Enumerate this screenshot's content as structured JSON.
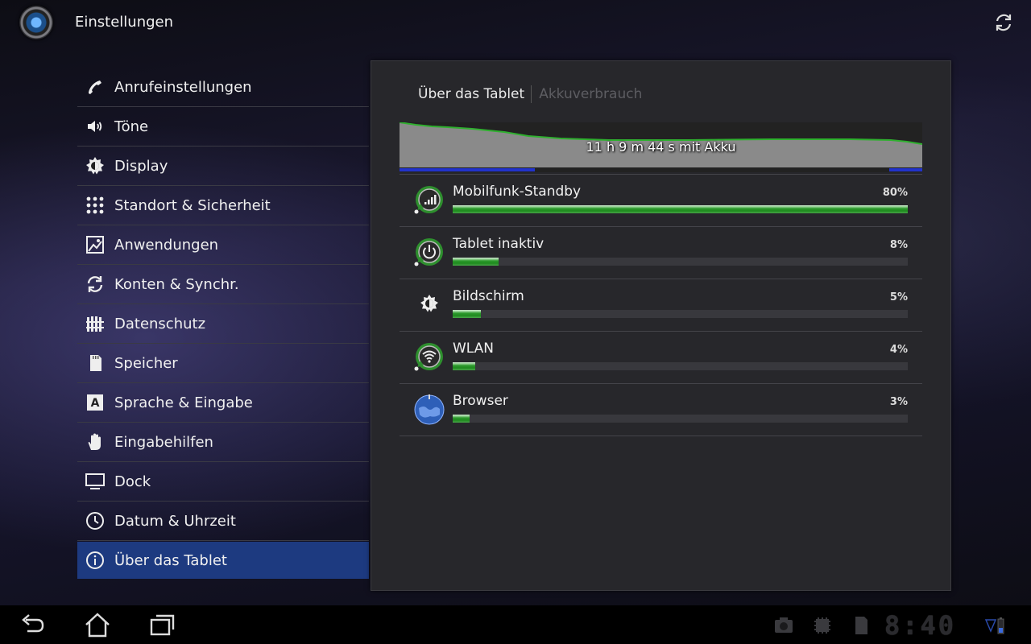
{
  "actionbar": {
    "title": "Einstellungen"
  },
  "sidebar": {
    "items": [
      {
        "label": "Anrufeinstellungen",
        "icon": "phone-icon"
      },
      {
        "label": "Töne",
        "icon": "speaker-icon"
      },
      {
        "label": "Display",
        "icon": "brightness-icon"
      },
      {
        "label": "Standort & Sicherheit",
        "icon": "location-grid-icon"
      },
      {
        "label": "Anwendungen",
        "icon": "applications-icon"
      },
      {
        "label": "Konten & Synchr.",
        "icon": "sync-icon"
      },
      {
        "label": "Datenschutz",
        "icon": "fence-icon"
      },
      {
        "label": "Speicher",
        "icon": "sd-card-icon"
      },
      {
        "label": "Sprache & Eingabe",
        "icon": "language-icon"
      },
      {
        "label": "Eingabehilfen",
        "icon": "hand-icon"
      },
      {
        "label": "Dock",
        "icon": "monitor-icon"
      },
      {
        "label": "Datum & Uhrzeit",
        "icon": "clock-icon"
      },
      {
        "label": "Über das Tablet",
        "icon": "info-icon",
        "selected": true
      }
    ]
  },
  "breadcrumb": {
    "active": "Über das Tablet",
    "inactive": "Akkuverbrauch"
  },
  "battery": {
    "duration_text": "11 h 9 m 44 s mit Akku",
    "usage": [
      {
        "name": "Mobilfunk-Standby",
        "percent_label": "80%",
        "percent": 80,
        "icon": "cell-standby-icon"
      },
      {
        "name": "Tablet inaktiv",
        "percent_label": "8%",
        "percent": 8,
        "icon": "power-icon"
      },
      {
        "name": "Bildschirm",
        "percent_label": "5%",
        "percent": 5,
        "icon": "brightness-icon"
      },
      {
        "name": "WLAN",
        "percent_label": "4%",
        "percent": 4,
        "icon": "wifi-icon"
      },
      {
        "name": "Browser",
        "percent_label": "3%",
        "percent": 3,
        "icon": "globe-icon"
      }
    ]
  },
  "navbar": {
    "clock": "8:40",
    "buttons": [
      "back-icon",
      "home-icon",
      "recent-apps-icon"
    ],
    "status_icons": [
      "screenshot-icon",
      "chip-icon",
      "sd-card-icon",
      "battery-icon"
    ]
  },
  "colors": {
    "accent": "#1d3a80",
    "usage_bar": "#2e9b2e",
    "graph_line": "#2fb02f",
    "charge_line": "#2233cc"
  }
}
